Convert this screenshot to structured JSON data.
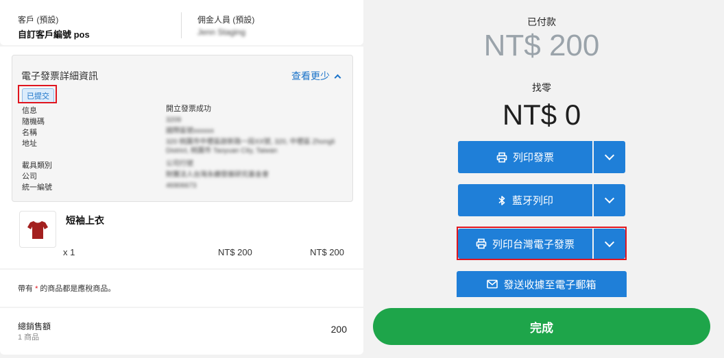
{
  "order": {
    "customer_label": "客戶 (預設)",
    "customer_value": "自訂客戶編號 pos",
    "salesperson_label": "佣金人員 (預設)",
    "salesperson_value": "Jenn Staging"
  },
  "einvoice": {
    "title": "電子發票詳細資訊",
    "toggle_label": "查看更少",
    "status_badge": "已提交",
    "fields": [
      {
        "label": "信息",
        "value": "開立發票成功"
      },
      {
        "label": "隨機碼",
        "value": "3209"
      },
      {
        "label": "名稱",
        "value": "國際區號xxxxxx"
      },
      {
        "label": "地址",
        "value": "320 桃園市中壢區啟新路一段XX號, 320, 中壢區 Zhongli District, 桃園市 Taoyuan City, Taiwan"
      },
      {
        "label": "載具類別",
        "value": "公司行號"
      },
      {
        "label": "公司",
        "value": "財團法人台灣永續發展研究基金會"
      },
      {
        "label": "統一編號",
        "value": "46906673"
      }
    ]
  },
  "line_item": {
    "name": "短袖上衣",
    "quantity": "x 1",
    "unit_price": "NT$ 200",
    "line_total": "NT$ 200",
    "thumbnail_icon": "tshirt-icon"
  },
  "tax_note": {
    "prefix": "帶有",
    "star": "*",
    "suffix": "的商品都是應稅商品。"
  },
  "totals": {
    "label": "總銷售額",
    "sub_label": "1 商品",
    "value": "200"
  },
  "payment": {
    "paid_label": "已付款",
    "paid_amount": "NT$ 200",
    "change_label": "找零",
    "change_amount": "NT$ 0"
  },
  "actions": {
    "print_invoice": "列印發票",
    "bluetooth_print": "藍牙列印",
    "print_tw_einvoice": "列印台灣電子發票",
    "email_receipt": "發送收據至電子郵箱",
    "done": "完成"
  },
  "colors": {
    "primary_blue": "#1f7fd8",
    "success_green": "#1ea54a",
    "highlight_red": "#e0141e",
    "link_blue": "#1a73c9"
  }
}
